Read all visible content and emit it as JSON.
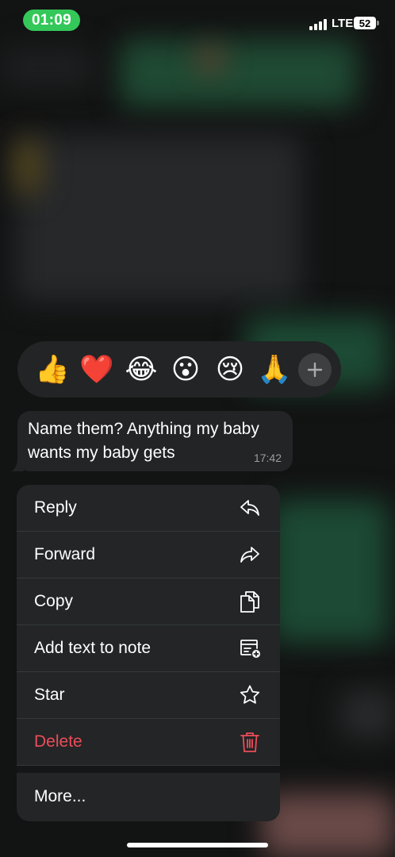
{
  "status_bar": {
    "time": "01:09",
    "network": "LTE",
    "battery": "52",
    "accent_color": "#34c759"
  },
  "reactions": {
    "emojis": [
      "👍",
      "❤️",
      "😂",
      "😮",
      "😢",
      "🙏"
    ],
    "more_icon": "plus-icon"
  },
  "message": {
    "text": "Name them? Anything my baby wants my baby gets",
    "time": "17:42"
  },
  "menu": {
    "items": [
      {
        "label": "Reply",
        "icon": "reply-icon"
      },
      {
        "label": "Forward",
        "icon": "forward-icon"
      },
      {
        "label": "Copy",
        "icon": "copy-icon"
      },
      {
        "label": "Add text to note",
        "icon": "note-add-icon"
      },
      {
        "label": "Star",
        "icon": "star-icon"
      },
      {
        "label": "Delete",
        "icon": "trash-icon",
        "color": "#eb4d59"
      },
      {
        "label": "More...",
        "icon": ""
      }
    ]
  }
}
